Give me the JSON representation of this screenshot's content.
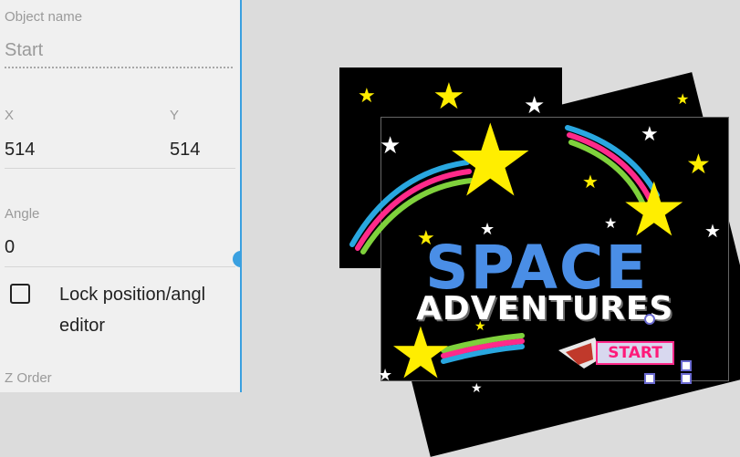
{
  "properties": {
    "object_name_label": "Object name",
    "object_name_placeholder": "Start",
    "x_label": "X",
    "y_label": "Y",
    "x_value": "514",
    "y_value": "514",
    "angle_label": "Angle",
    "angle_value": "0",
    "lock_label_line1": "Lock position/angl",
    "lock_label_line2": "editor",
    "z_order_label": "Z Order"
  },
  "scene": {
    "title_line1": "SPACE",
    "title_line2": "ADVENTURES",
    "start_label": "START"
  },
  "colors": {
    "accent": "#3aa0e0",
    "title_blue": "#4a8ee6",
    "star_yellow": "#ffee00",
    "start_pink": "#ff1a7a"
  }
}
